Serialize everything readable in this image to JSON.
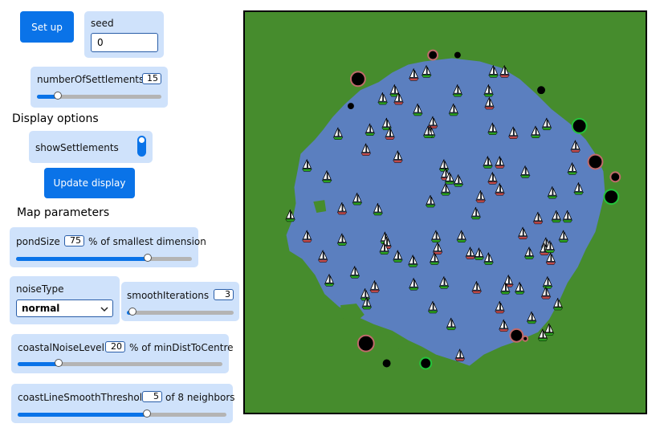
{
  "controls": {
    "setup_label": "Set up",
    "seed": {
      "label": "seed",
      "value": "0"
    },
    "numberOfSettlements": {
      "label": "numberOfSettlements",
      "value": "15",
      "fraction": 0.17
    },
    "display_heading": "Display options",
    "showSettlements": {
      "label": "showSettlements",
      "on": true
    },
    "update_label": "Update display",
    "map_heading": "Map parameters",
    "pondSize": {
      "label": "pondSize",
      "value": "75",
      "unit": "% of smallest dimension",
      "fraction": 0.75
    },
    "noiseType": {
      "label": "noiseType",
      "value": "normal"
    },
    "smoothIterations": {
      "label": "smoothIterations",
      "value": "3",
      "fraction": 0.05
    },
    "coastalNoiseLevel": {
      "label": "coastalNoiseLevel",
      "value": "20",
      "unit": "% of minDistToCentre",
      "fraction": 0.2
    },
    "coastLineSmoothThreshold": {
      "label": "coastLineSmoothThreshold",
      "value": "5",
      "unit": "of 8 neighbors",
      "fraction": 0.62
    }
  },
  "colors": {
    "land": "#468c2d",
    "water": "#5b7fbf",
    "accent": "#0a73e8",
    "settlement_fill": "#000000",
    "settlement_rings": [
      "#c06a6a",
      "#23c43a"
    ],
    "boat_hull_colors": [
      "#2ba31f",
      "#c14a4a"
    ]
  },
  "map": {
    "icons": [
      "boat-icon",
      "settlement-icon"
    ]
  }
}
